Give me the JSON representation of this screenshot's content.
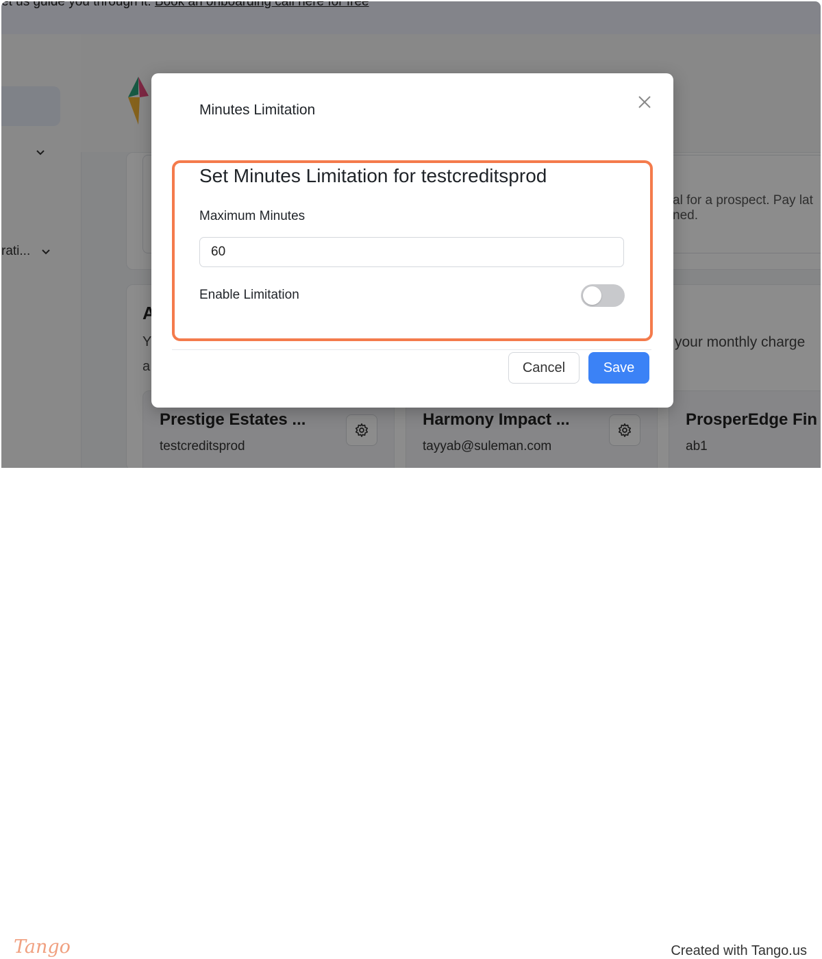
{
  "banner": {
    "text": "et us guide you through it. ",
    "link": "Book an onboarding call here for free"
  },
  "sidebar": {
    "item_truncated": "rati..."
  },
  "background": {
    "text_line1": "al for a prospect. Pay lat",
    "text_line2": "ned.",
    "heading_fragment": "A",
    "text_fragment_y": "Y",
    "text_fragment_a": "a",
    "charge_text": "your monthly charge",
    "accounts": [
      {
        "name": "Prestige Estates ...",
        "sub": "testcreditsprod"
      },
      {
        "name": "Harmony Impact ...",
        "sub": "tayyab@suleman.com"
      },
      {
        "name": "ProsperEdge Fin",
        "sub": "ab1"
      }
    ]
  },
  "modal": {
    "title": "Minutes Limitation",
    "heading": "Set Minutes Limitation for testcreditsprod",
    "max_minutes_label": "Maximum Minutes",
    "max_minutes_value": "60",
    "enable_label": "Enable Limitation",
    "enable_state": false,
    "cancel_label": "Cancel",
    "save_label": "Save"
  },
  "colors": {
    "primary": "#3b82f6",
    "highlight": "#f47b4c",
    "toggle_off": "#c8c9cc"
  },
  "footer": {
    "logo": "Tango",
    "credit": "Created with Tango.us"
  }
}
